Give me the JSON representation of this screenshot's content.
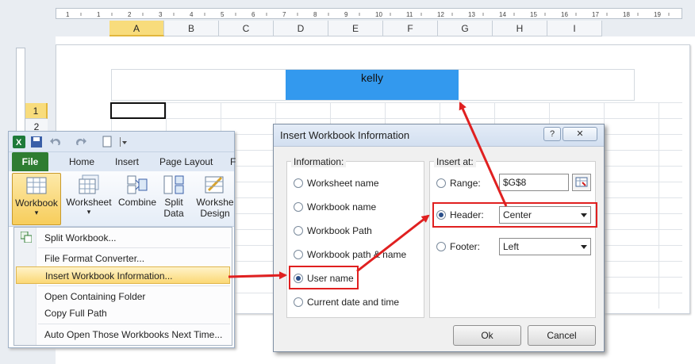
{
  "sheet": {
    "columns": [
      "A",
      "B",
      "C",
      "D",
      "E",
      "F",
      "G",
      "H",
      "I"
    ],
    "ruler_marks": [
      "1",
      "1",
      "2",
      "3",
      "4",
      "5",
      "6",
      "7",
      "8",
      "9",
      "10",
      "11",
      "12",
      "13",
      "14",
      "15",
      "16",
      "17",
      "18",
      "19"
    ],
    "rows": [
      "1",
      "2"
    ],
    "header_cell_text": "kelly"
  },
  "ribbon": {
    "file_tab": "File",
    "tabs": [
      "Home",
      "Insert",
      "Page Layout",
      "F"
    ],
    "buttons": [
      {
        "label": "Workbook",
        "sub": "▾"
      },
      {
        "label": "Worksheet",
        "sub": "▾"
      },
      {
        "label": "Combine",
        "sub": ""
      },
      {
        "label": "Split",
        "sub": "Data"
      },
      {
        "label": "Workshe",
        "sub": "Design"
      }
    ],
    "menu": [
      "Split Workbook...",
      "File Format Converter...",
      "Insert Workbook Information...",
      "Open Containing Folder",
      "Copy Full Path",
      "Auto Open Those Workbooks Next Time..."
    ]
  },
  "dialog": {
    "title": "Insert Workbook Information",
    "help": "?",
    "close": "✕",
    "information_label": "Information:",
    "information_options": [
      {
        "label": "Worksheet name",
        "checked": false
      },
      {
        "label": "Workbook name",
        "checked": false
      },
      {
        "label": "Workbook Path",
        "checked": false
      },
      {
        "label": "Workbook path & name",
        "checked": false
      },
      {
        "label": "User name",
        "checked": true
      },
      {
        "label": "Current date and time",
        "checked": false
      }
    ],
    "insert_at_label": "Insert at:",
    "range_label": "Range:",
    "range_value": "$G$8",
    "header_label": "Header:",
    "header_value": "Center",
    "footer_label": "Footer:",
    "footer_value": "Left",
    "ok": "Ok",
    "cancel": "Cancel"
  },
  "colors": {
    "accent": "#3399ee",
    "highlight_box": "#e02020",
    "file_tab": "#2f7d32"
  }
}
